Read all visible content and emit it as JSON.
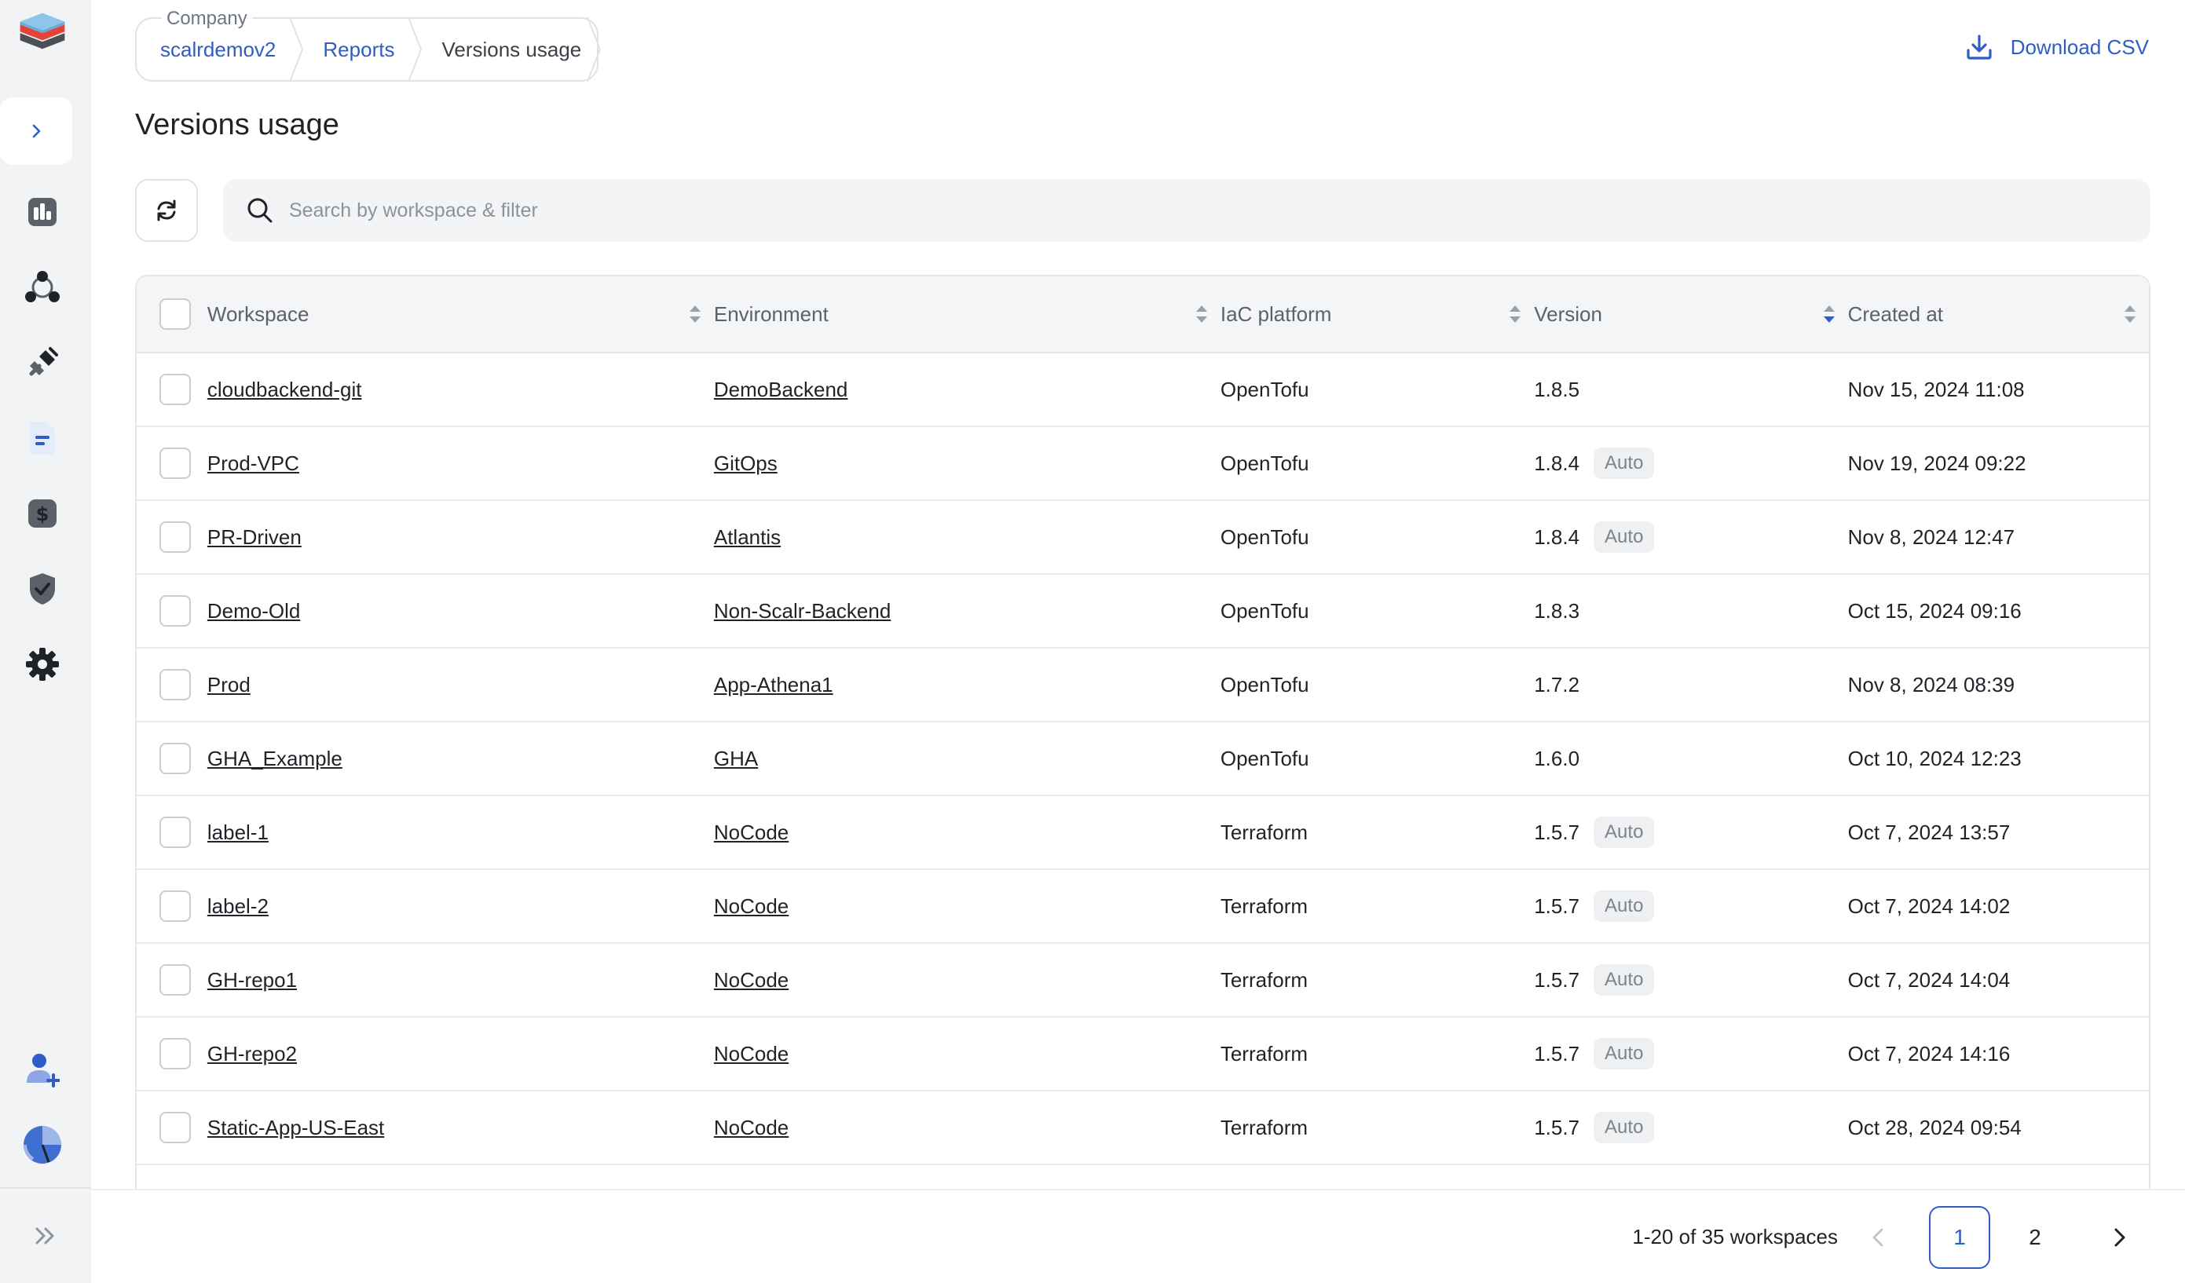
{
  "breadcrumb": {
    "context_label": "Company",
    "items": [
      "scalrdemov2",
      "Reports",
      "Versions usage"
    ]
  },
  "header": {
    "download_label": "Download CSV",
    "title": "Versions usage"
  },
  "search": {
    "placeholder": "Search by workspace & filter"
  },
  "table": {
    "columns": [
      "Workspace",
      "Environment",
      "IaC platform",
      "Version",
      "Created at"
    ],
    "rows": [
      {
        "workspace": "cloudbackend-git",
        "environment": "DemoBackend",
        "iac": "OpenTofu",
        "version": "1.8.5",
        "badge": "",
        "created": "Nov 15, 2024 11:08"
      },
      {
        "workspace": "Prod-VPC",
        "environment": "GitOps",
        "iac": "OpenTofu",
        "version": "1.8.4",
        "badge": "Auto",
        "created": "Nov 19, 2024 09:22"
      },
      {
        "workspace": "PR-Driven",
        "environment": "Atlantis",
        "iac": "OpenTofu",
        "version": "1.8.4",
        "badge": "Auto",
        "created": "Nov 8, 2024 12:47"
      },
      {
        "workspace": "Demo-Old",
        "environment": "Non-Scalr-Backend",
        "iac": "OpenTofu",
        "version": "1.8.3",
        "badge": "",
        "created": "Oct 15, 2024 09:16"
      },
      {
        "workspace": "Prod",
        "environment": "App-Athena1",
        "iac": "OpenTofu",
        "version": "1.7.2",
        "badge": "",
        "created": "Nov 8, 2024 08:39"
      },
      {
        "workspace": "GHA_Example",
        "environment": "GHA",
        "iac": "OpenTofu",
        "version": "1.6.0",
        "badge": "",
        "created": "Oct 10, 2024 12:23"
      },
      {
        "workspace": "label-1",
        "environment": "NoCode",
        "iac": "Terraform",
        "version": "1.5.7",
        "badge": "Auto",
        "created": "Oct 7, 2024 13:57"
      },
      {
        "workspace": "label-2",
        "environment": "NoCode",
        "iac": "Terraform",
        "version": "1.5.7",
        "badge": "Auto",
        "created": "Oct 7, 2024 14:02"
      },
      {
        "workspace": "GH-repo1",
        "environment": "NoCode",
        "iac": "Terraform",
        "version": "1.5.7",
        "badge": "Auto",
        "created": "Oct 7, 2024 14:04"
      },
      {
        "workspace": "GH-repo2",
        "environment": "NoCode",
        "iac": "Terraform",
        "version": "1.5.7",
        "badge": "Auto",
        "created": "Oct 7, 2024 14:16"
      },
      {
        "workspace": "Static-App-US-East",
        "environment": "NoCode",
        "iac": "Terraform",
        "version": "1.5.7",
        "badge": "Auto",
        "created": "Oct 28, 2024 09:54"
      }
    ]
  },
  "pagination": {
    "summary": "1-20 of 35 workspaces",
    "pages": [
      "1",
      "2"
    ],
    "current_page": "1"
  },
  "sidebar": {
    "icons": [
      "dashboard-icon",
      "modules-icon",
      "integrations-icon",
      "reports-icon",
      "billing-icon",
      "policies-icon",
      "settings-icon",
      "add-user-icon",
      "user-avatar",
      "collapse-icon"
    ]
  },
  "colors": {
    "accent": "#2f5cc7",
    "sidebar_bg": "#f2f3f5",
    "logo_top": "#8ec5ea",
    "logo_middle": "#e2433a",
    "logo_bottom": "#4b4f56"
  }
}
